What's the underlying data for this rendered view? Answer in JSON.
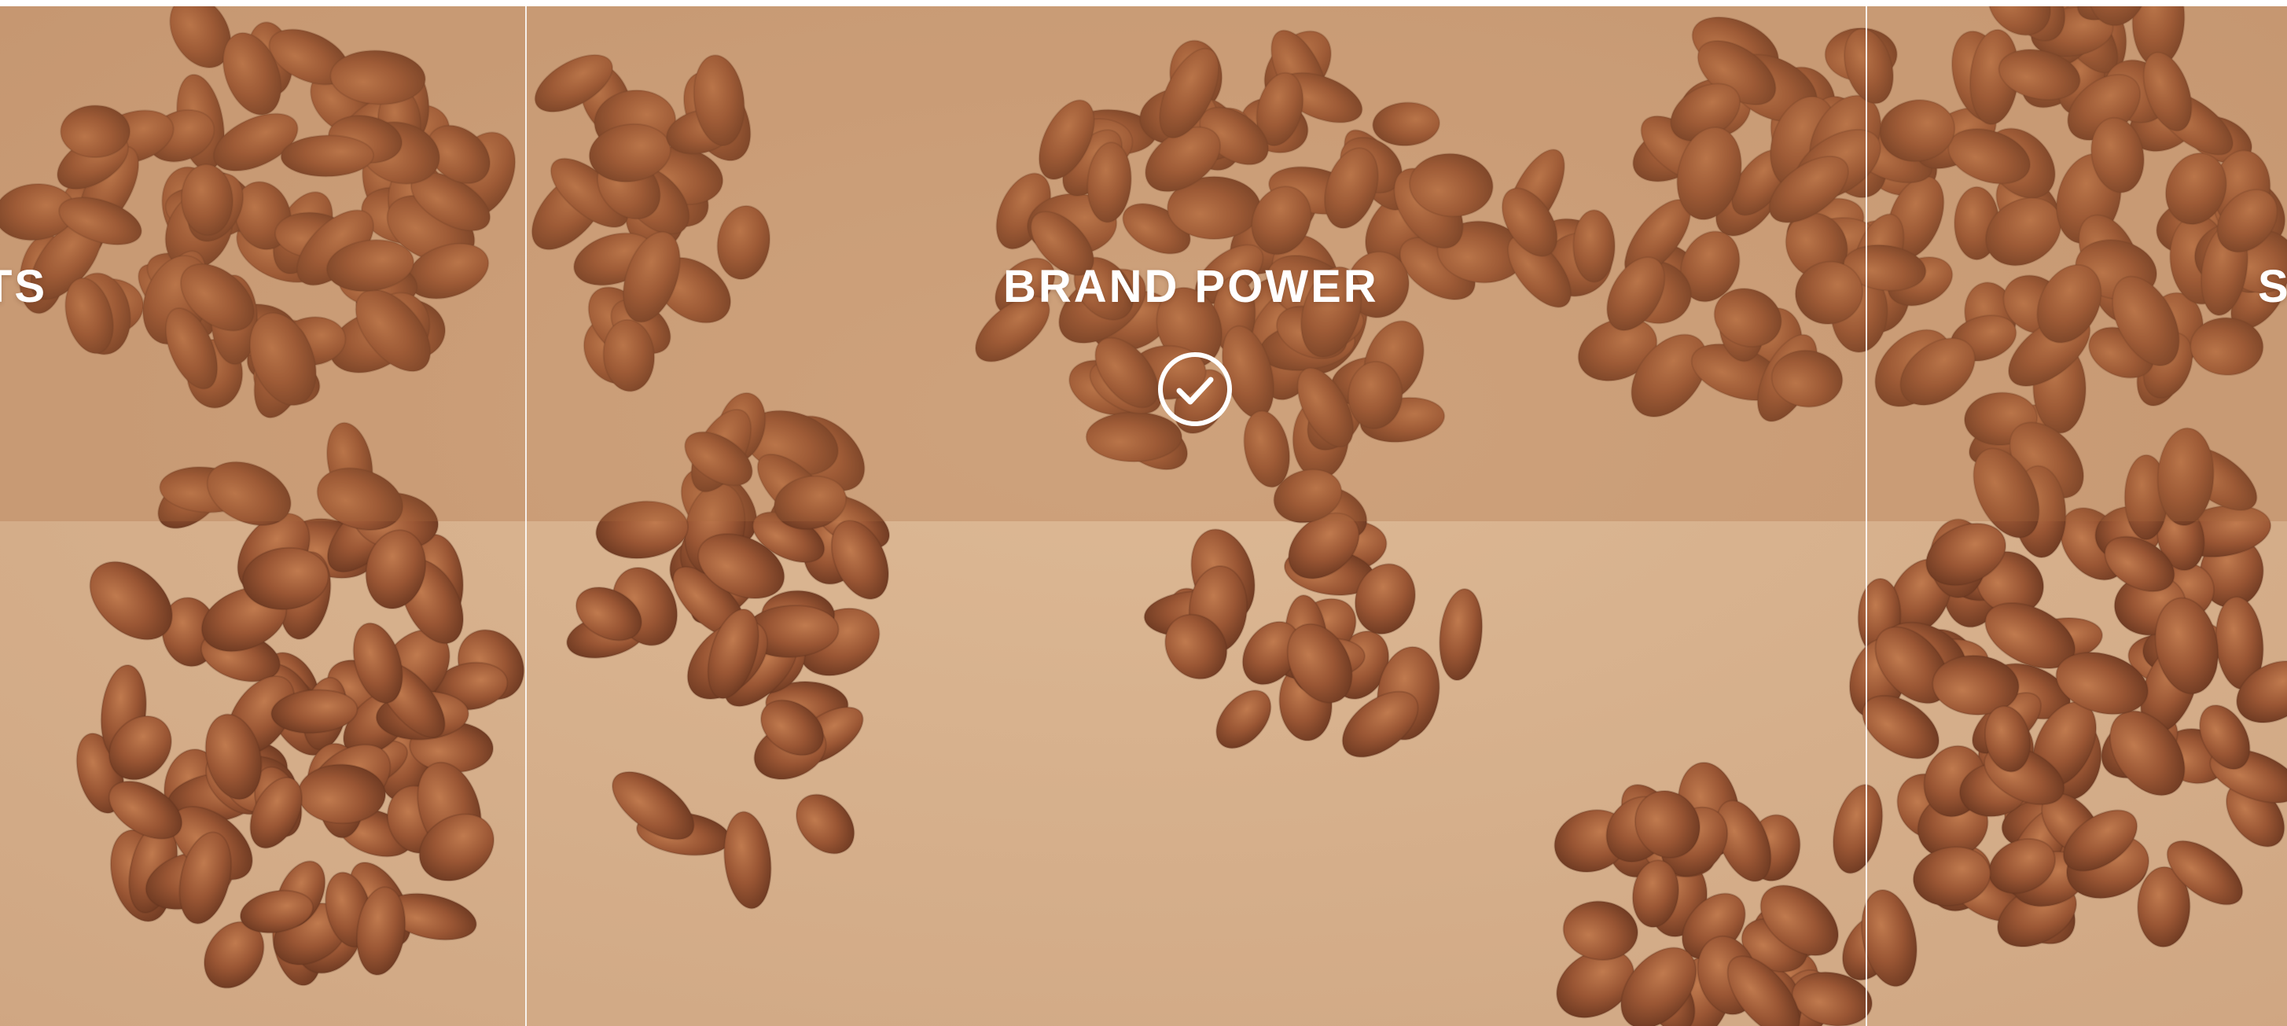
{
  "panels": {
    "left": {
      "title": "TS"
    },
    "center": {
      "title": "BRAND POWER",
      "icon": "check-circle-icon"
    },
    "right": {
      "title": "S"
    }
  },
  "colors": {
    "background": "#d4ad88",
    "bean_dark": "#6e3a22",
    "bean_mid": "#9a5634",
    "bean_light": "#b8734a",
    "overlay": "#a8683e",
    "text": "#ffffff"
  }
}
